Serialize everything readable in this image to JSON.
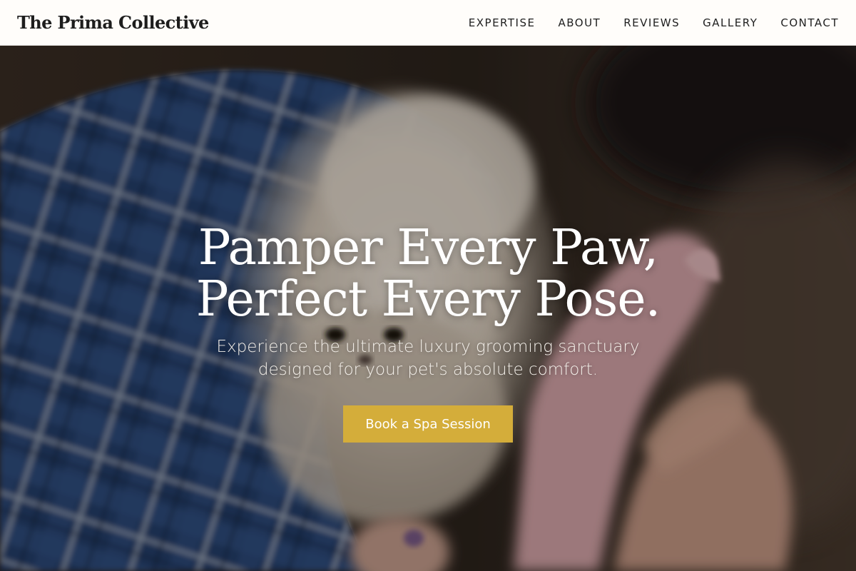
{
  "header": {
    "brand": "The Prima Collective",
    "nav": [
      {
        "label": "EXPERTISE"
      },
      {
        "label": "ABOUT"
      },
      {
        "label": "REVIEWS"
      },
      {
        "label": "GALLERY"
      },
      {
        "label": "CONTACT"
      }
    ]
  },
  "hero": {
    "title_line1": "Pamper Every Paw,",
    "title_line2": "Perfect Every Pose.",
    "subtitle": "Experience the ultimate luxury grooming sanctuary designed for your pet's absolute comfort.",
    "cta_label": "Book a Spa Session",
    "photo_subject": "small-fluffy-dog-wrapped-in-blue-plaid-blanket-being-brushed"
  },
  "colors": {
    "accent": "#d4ad3a",
    "navbar_bg": "#fffdfa",
    "text_dark": "#1d1d1d",
    "hero_text": "#ffffff"
  }
}
